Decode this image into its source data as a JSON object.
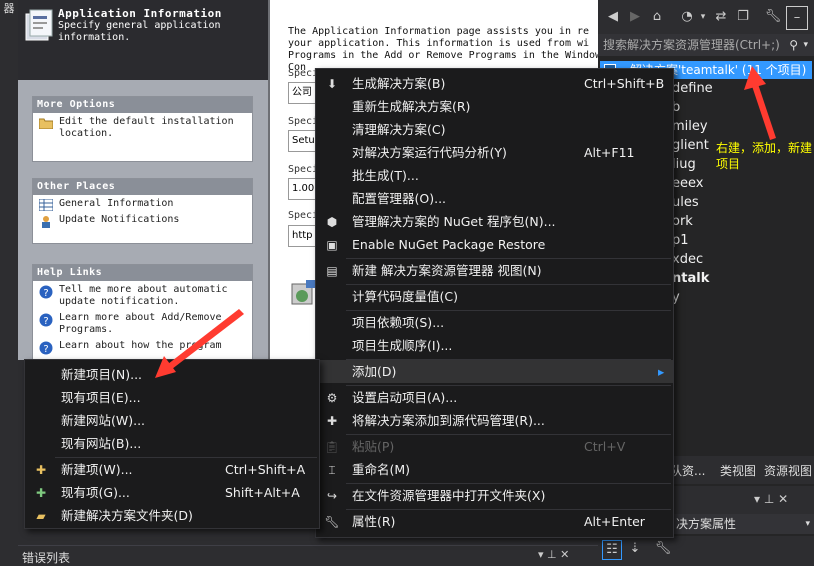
{
  "left_strip": {
    "label": "器"
  },
  "wizard": {
    "header": {
      "title": "Application Information",
      "subtitle": "Specify general application information."
    },
    "panels": [
      {
        "title": "More Options",
        "items": [
          {
            "label": "Edit the default installation location.",
            "icon": "folder-icon"
          }
        ]
      },
      {
        "title": "Other Places",
        "items": [
          {
            "label": "General Information",
            "icon": "table-icon"
          },
          {
            "label": "Update Notifications",
            "icon": "update-icon"
          }
        ]
      },
      {
        "title": "Help Links",
        "items": [
          {
            "label": "Tell me more about automatic update notification.",
            "icon": "help-icon"
          },
          {
            "label": "Learn more about Add/Remove Programs.",
            "icon": "help-icon"
          },
          {
            "label": "Learn about how the program",
            "icon": "help-icon"
          }
        ]
      }
    ],
    "description": "The Application Information page assists you in re your application. This information is used from wi Programs in the Add or Remove Programs in the Windows Con",
    "fields": [
      {
        "label": "Speci",
        "value": "公司"
      },
      {
        "label": "Speci",
        "value": "Setu"
      },
      {
        "label": "Speci",
        "value": "1.00"
      },
      {
        "label": "Speci",
        "value": "http"
      }
    ]
  },
  "solution_explorer": {
    "toolbar_icons": [
      "back-icon",
      "forward-icon",
      "home-icon",
      "history-icon",
      "sync-icon",
      "collapse-icon",
      "wrench-icon",
      "pin-icon"
    ],
    "search_placeholder": "搜索解决方案资源管理器(Ctrl+;)",
    "root_label": "解决方案'teamtalk' (11 个项目)",
    "nodes": [
      "define",
      "b",
      "miley",
      "glient",
      "liug",
      "eeex",
      "ules",
      "ork",
      "p1",
      "xdec",
      "ntalk",
      "y"
    ],
    "annotation": "右建，添加，新建项目",
    "tabs": [
      "队资...",
      "类视图",
      "资源视图"
    ],
    "props_pin": "▾ ⊥ ✕",
    "props_name": "决方案属性"
  },
  "bottom_tab": "错误列表",
  "context_menu": {
    "items": [
      {
        "label": "生成解决方案(B)",
        "shortcut": "Ctrl+Shift+B",
        "icon": "build-icon",
        "disabled": false
      },
      {
        "label": "重新生成解决方案(R)",
        "shortcut": "",
        "icon": "",
        "disabled": false
      },
      {
        "label": "清理解决方案(C)",
        "shortcut": "",
        "icon": "",
        "disabled": false
      },
      {
        "label": "对解决方案运行代码分析(Y)",
        "shortcut": "Alt+F11",
        "icon": "",
        "disabled": false
      },
      {
        "label": "批生成(T)...",
        "shortcut": "",
        "icon": "",
        "disabled": false
      },
      {
        "label": "配置管理器(O)...",
        "shortcut": "",
        "icon": "",
        "disabled": false
      },
      {
        "label": "管理解决方案的 NuGet 程序包(N)...",
        "shortcut": "",
        "icon": "nuget-icon",
        "disabled": false
      },
      {
        "label": "Enable NuGet Package Restore",
        "shortcut": "",
        "icon": "restore-icon",
        "disabled": false
      },
      {
        "label": "新建 解决方案资源管理器 视图(N)",
        "shortcut": "",
        "icon": "new-view-icon",
        "disabled": false
      },
      {
        "label": "计算代码度量值(C)",
        "shortcut": "",
        "icon": "",
        "disabled": false
      },
      {
        "label": "项目依赖项(S)...",
        "shortcut": "",
        "icon": "",
        "disabled": false
      },
      {
        "label": "项目生成顺序(I)...",
        "shortcut": "",
        "icon": "",
        "disabled": false
      },
      {
        "label": "添加(D)",
        "shortcut": "",
        "icon": "",
        "disabled": false,
        "submenu": true
      },
      {
        "label": "设置启动项目(A)...",
        "shortcut": "",
        "icon": "gear-icon",
        "disabled": false
      },
      {
        "label": "将解决方案添加到源代码管理(R)...",
        "shortcut": "",
        "icon": "source-control-icon",
        "disabled": false
      },
      {
        "label": "粘贴(P)",
        "shortcut": "Ctrl+V",
        "icon": "paste-icon",
        "disabled": true
      },
      {
        "label": "重命名(M)",
        "shortcut": "",
        "icon": "rename-icon",
        "disabled": false
      },
      {
        "label": "在文件资源管理器中打开文件夹(X)",
        "shortcut": "",
        "icon": "open-folder-icon",
        "disabled": false
      },
      {
        "label": "属性(R)",
        "shortcut": "Alt+Enter",
        "icon": "wrench-icon",
        "disabled": false
      }
    ],
    "submenu_arrow": "▸"
  },
  "add_submenu": {
    "items": [
      {
        "label": "新建项目(N)...",
        "shortcut": "",
        "icon": ""
      },
      {
        "label": "现有项目(E)...",
        "shortcut": "",
        "icon": ""
      },
      {
        "label": "新建网站(W)...",
        "shortcut": "",
        "icon": ""
      },
      {
        "label": "现有网站(B)...",
        "shortcut": "",
        "icon": ""
      },
      {
        "label": "新建项(W)...",
        "shortcut": "Ctrl+Shift+A",
        "icon": "new-item-icon"
      },
      {
        "label": "现有项(G)...",
        "shortcut": "Shift+Alt+A",
        "icon": "existing-item-icon"
      },
      {
        "label": "新建解决方案文件夹(D)",
        "shortcut": "",
        "icon": "new-folder-icon"
      }
    ]
  },
  "colors": {
    "annotation": "#ffff00",
    "arrow": "#ff3b30",
    "selection": "#3399ff",
    "menu_bg": "#1b1b1c"
  }
}
